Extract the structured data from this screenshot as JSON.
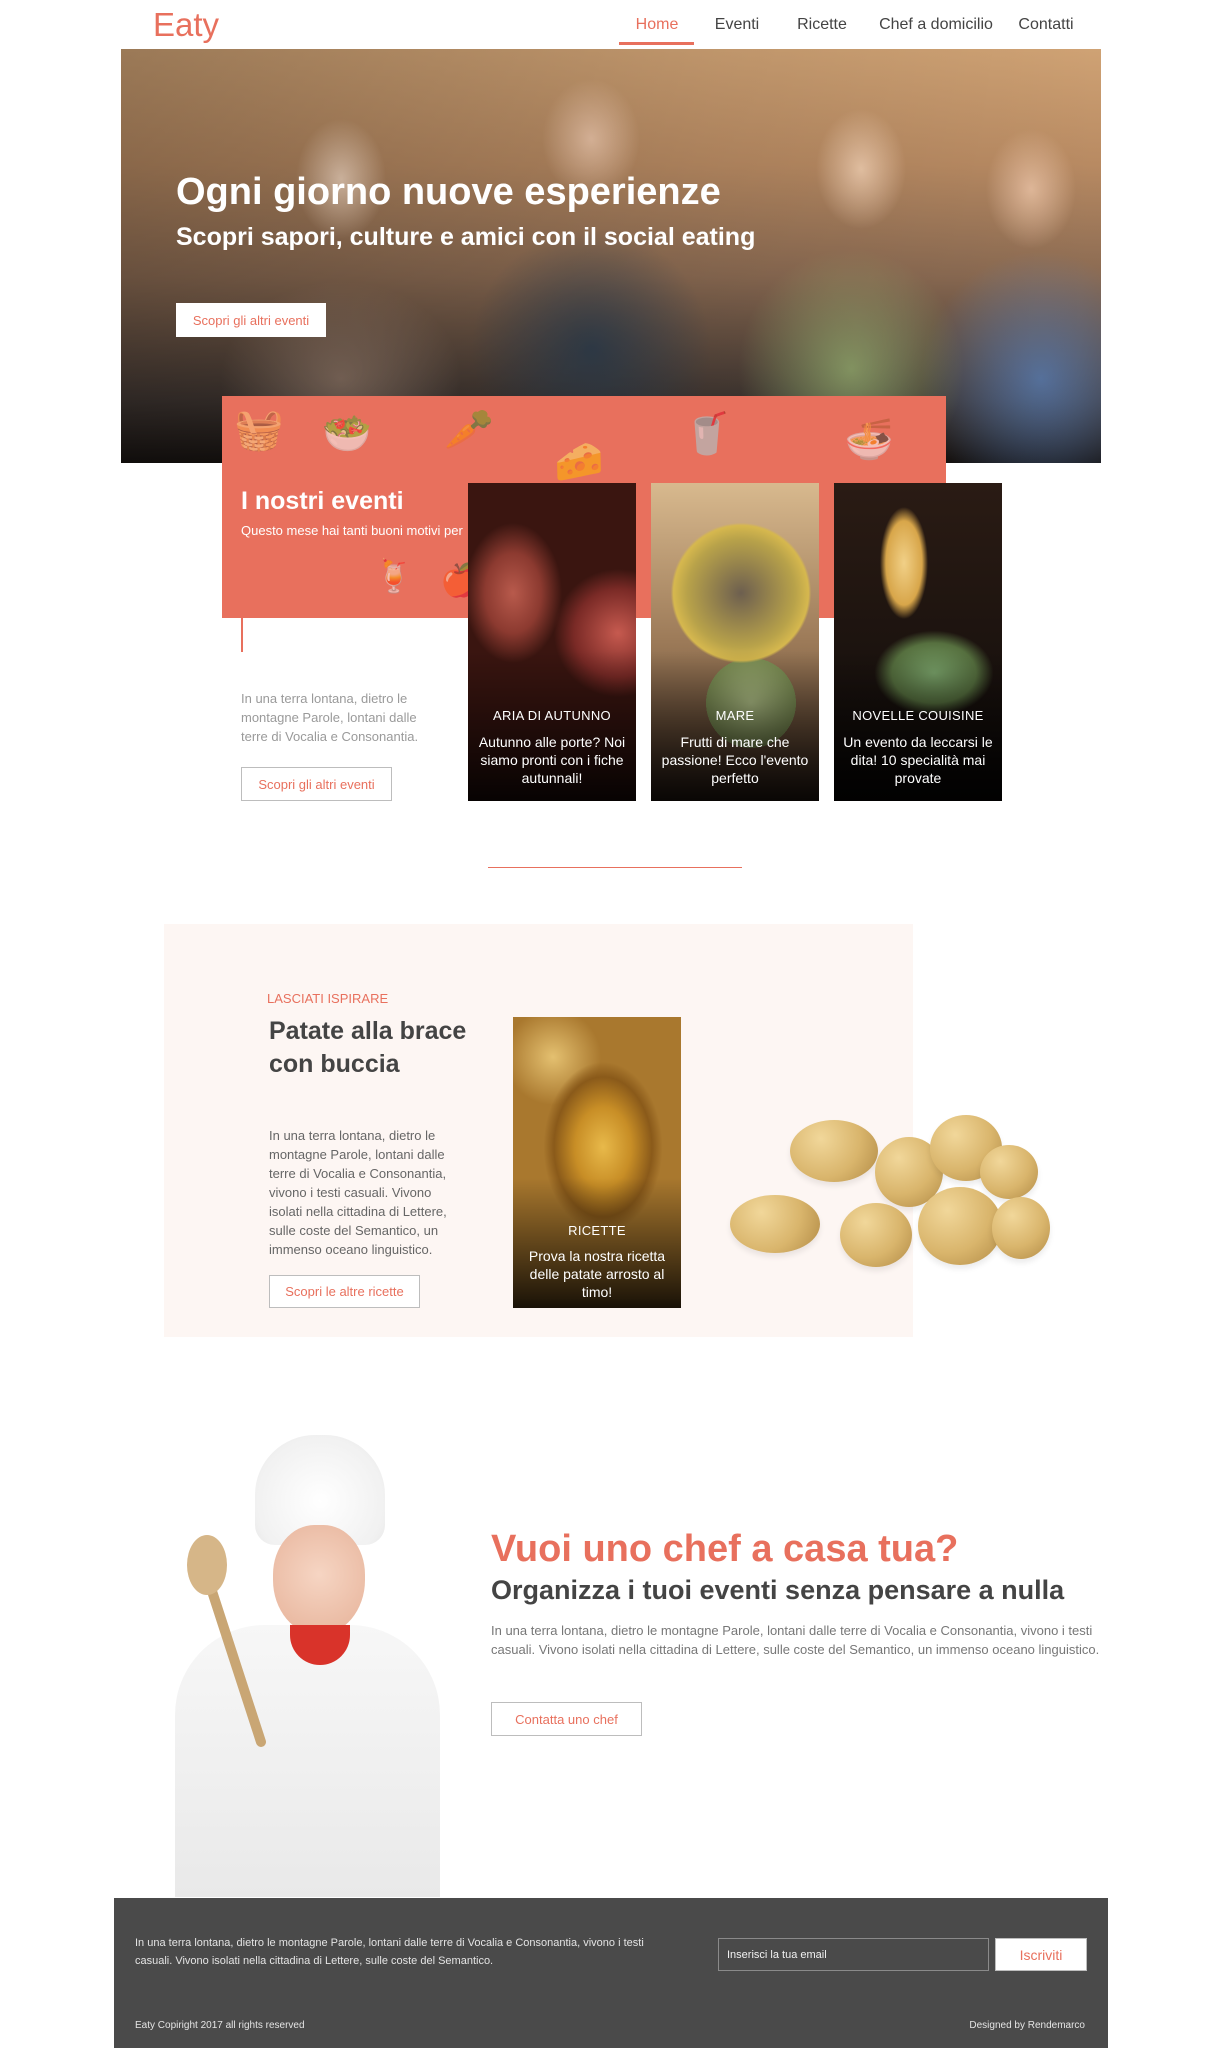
{
  "header": {
    "logo": "Eaty",
    "nav": [
      {
        "label": "Home",
        "active": true
      },
      {
        "label": "Eventi",
        "active": false
      },
      {
        "label": "Ricette",
        "active": false
      },
      {
        "label": "Chef a domicilio",
        "active": false
      },
      {
        "label": "Contatti",
        "active": false
      }
    ]
  },
  "hero": {
    "title": "Ogni giorno nuove esperienze",
    "subtitle": "Scopri sapori, culture e amici con il social eating",
    "button": "Scopri gli altri eventi"
  },
  "events": {
    "title": "I nostri eventi",
    "subtitle": "Questo mese hai tanti buoni motivi per",
    "text": "In una terra lontana, dietro le montagne Parole, lontani dalle terre di Vocalia e Consonantia.",
    "button": "Scopri gli altri eventi",
    "cards": [
      {
        "category": "ARIA DI AUTUNNO",
        "description": "Autunno alle porte? Noi siamo pronti con i fiche autunnali!"
      },
      {
        "category": "MARE",
        "description": "Frutti di mare che passione! Ecco l'evento perfetto"
      },
      {
        "category": "NOVELLE COUISINE",
        "description": "Un evento da leccarsi le dita! 10 specialità mai provate"
      }
    ]
  },
  "recipe": {
    "tag": "LASCIATI ISPIRARE",
    "title": "Patate alla brace con buccia",
    "text": "In una terra lontana, dietro le montagne Parole, lontani dalle terre di Vocalia e Consonantia, vivono i testi casuali. Vivono isolati nella cittadina di Lettere, sulle coste del Semantico, un immenso oceano linguistico.",
    "button": "Scopri le altre ricette",
    "card": {
      "category": "RICETTE",
      "description": "Prova la nostra ricetta delle patate arrosto al timo!"
    }
  },
  "chef": {
    "title": "Vuoi uno chef a casa tua?",
    "subtitle": "Organizza i tuoi eventi senza pensare a nulla",
    "text": "In una terra lontana, dietro le montagne Parole, lontani dalle terre di Vocalia e Consonantia, vivono i testi casuali. Vivono isolati nella cittadina di Lettere, sulle coste del Semantico, un immenso oceano linguistico.",
    "button": "Contatta uno chef"
  },
  "footer": {
    "text": "In una terra lontana, dietro le montagne Parole, lontani dalle terre di Vocalia e Consonantia, vivono i testi casuali. Vivono isolati nella cittadina di Lettere, sulle coste del Semantico.",
    "email_placeholder": "Inserisci la tua email",
    "subscribe": "Iscriviti",
    "copyright": "Eaty Copiright 2017 all rights reserved",
    "designed_by": "Designed by Rendemarco"
  },
  "colors": {
    "accent": "#e8705d",
    "footer_bg": "#4a4a4a",
    "recipe_bg": "#fdf6f3"
  },
  "icons": [
    "bread-basket-icon",
    "salad-bowl-icon",
    "carrot-icon",
    "cheese-icon",
    "smoothie-icon",
    "noodles-icon",
    "juice-glass-icon",
    "apple-icon"
  ]
}
